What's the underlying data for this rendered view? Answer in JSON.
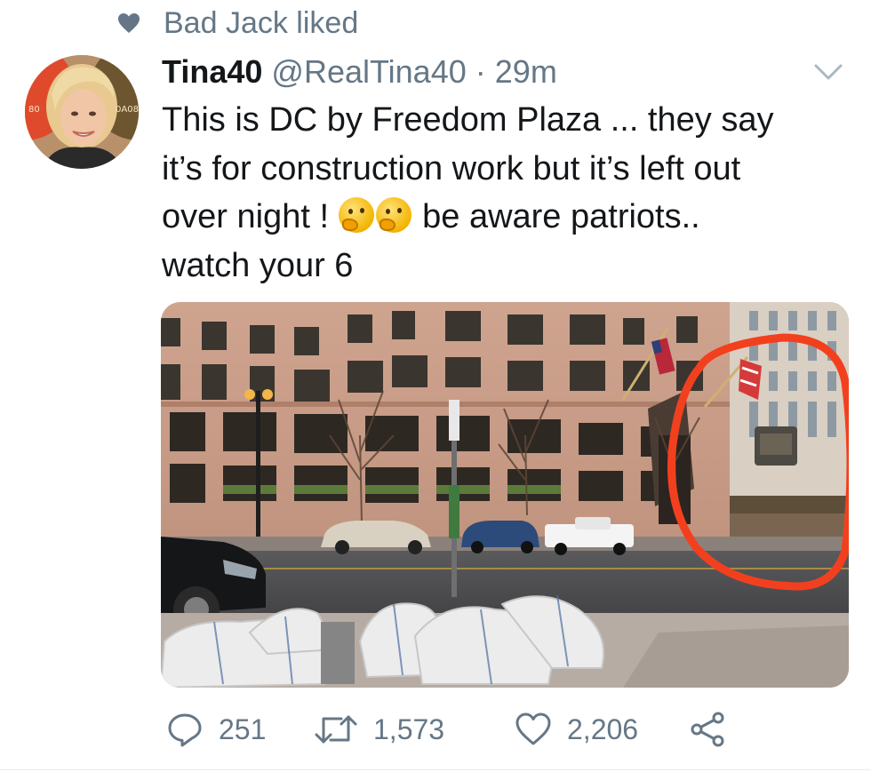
{
  "social_context": {
    "icon": "heart-icon",
    "text": "Bad Jack liked"
  },
  "tweet": {
    "display_name": "Tina40",
    "handle": "@RealTina40",
    "separator": "·",
    "time": "29m",
    "text_line1": "This is DC by Freedom Plaza ... they say",
    "text_line2": "it’s for construction work but it’s left out",
    "text_line3_before": "over night ! ",
    "emoji": "thinking-face",
    "text_line3_after": " be aware patriots..",
    "text_line4": "watch your 6"
  },
  "actions": {
    "reply_count": "251",
    "retweet_count": "1,573",
    "like_count": "2,206"
  },
  "colors": {
    "text": "#14171a",
    "muted": "#657786",
    "circle_annotation": "#f2401f"
  }
}
